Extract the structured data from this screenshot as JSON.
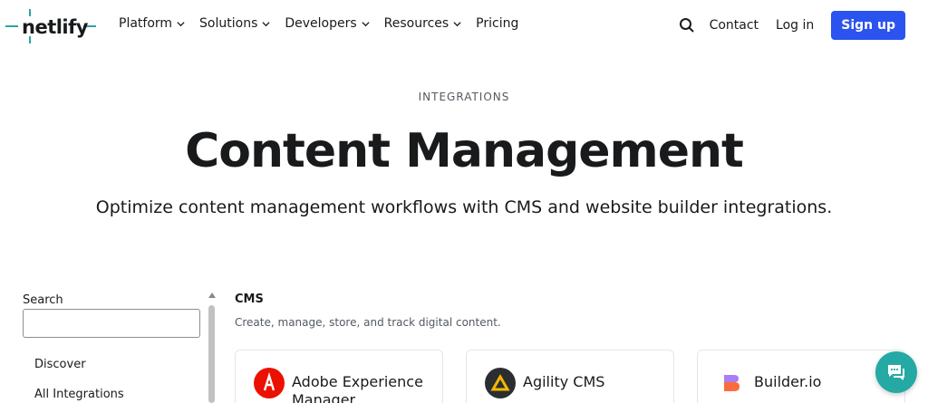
{
  "brand": {
    "name": "netlify",
    "accent": "#2ca5a0"
  },
  "nav": {
    "items": [
      {
        "label": "Platform",
        "has_menu": true
      },
      {
        "label": "Solutions",
        "has_menu": true
      },
      {
        "label": "Developers",
        "has_menu": true
      },
      {
        "label": "Resources",
        "has_menu": true
      },
      {
        "label": "Pricing",
        "has_menu": false
      }
    ],
    "search_icon": "search-icon",
    "contact_label": "Contact",
    "login_label": "Log in",
    "signup_label": "Sign up",
    "signup_color": "#2b53f0"
  },
  "hero": {
    "eyebrow": "INTEGRATIONS",
    "title": "Content Management",
    "subtitle": "Optimize content management workflows with CMS and website builder integrations."
  },
  "sidebar": {
    "search_label": "Search",
    "search_value": "",
    "items": [
      {
        "label": "Discover"
      },
      {
        "label": "All Integrations"
      }
    ]
  },
  "main": {
    "category_title": "CMS",
    "category_description": "Create, manage, store, and track digital content.",
    "cards": [
      {
        "name": "Adobe Experience Manager",
        "icon": "adobe-icon"
      },
      {
        "name": "Agility CMS",
        "icon": "agility-icon"
      },
      {
        "name": "Builder.io",
        "icon": "builder-io-icon"
      }
    ]
  },
  "chat": {
    "icon": "chat-icon",
    "color": "#25a9a4"
  }
}
